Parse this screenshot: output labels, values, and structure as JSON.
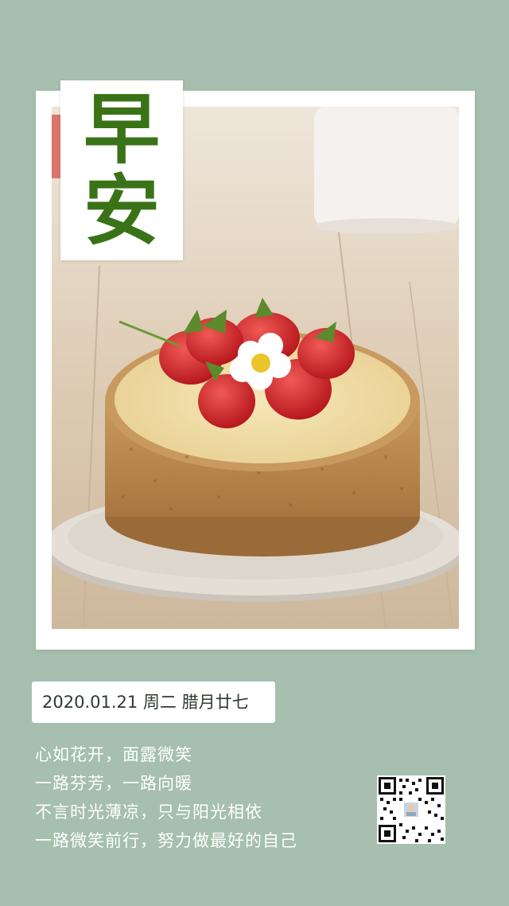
{
  "greeting": {
    "char1": "早",
    "char2": "安"
  },
  "date": {
    "text": "2020.01.21 周二 腊月廿七"
  },
  "poem": {
    "lines": [
      "心如花开，面露微笑",
      "一路芬芳，一路向暖",
      "不言时光薄凉，只与阳光相依",
      "一路微笑前行，努力做最好的自己"
    ]
  },
  "colors": {
    "background": "#a6bfae",
    "greeting_text": "#3a7317",
    "frame": "#ffffff"
  },
  "icons": {
    "qr": "qr-code-icon",
    "photo": "strawberry-cheesecake-photo"
  }
}
